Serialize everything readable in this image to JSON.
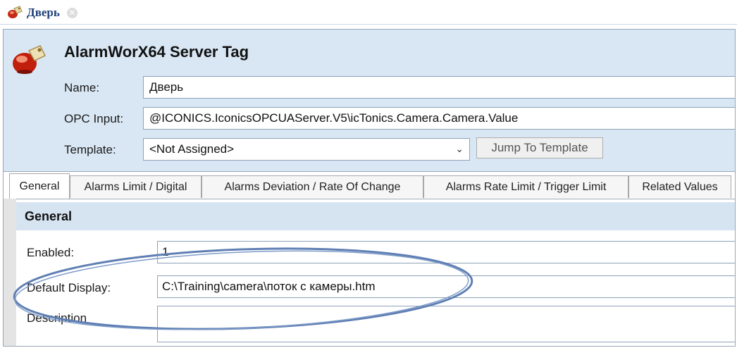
{
  "document_tab": {
    "title": "Дверь",
    "icon": "alarm-tag-icon",
    "close_icon": "close-icon"
  },
  "editor": {
    "title": "AlarmWorX64 Server Tag",
    "icon": "alarm-bell-icon",
    "fields": {
      "name_label": "Name:",
      "name_value": "Дверь",
      "opc_label": "OPC Input:",
      "opc_value": "@ICONICS.IconicsOPCUAServer.V5\\icTonics.Camera.Camera.Value",
      "template_label": "Template:",
      "template_value": "<Not Assigned>",
      "jump_button": "Jump To Template"
    },
    "tabs": [
      {
        "label": "General",
        "active": true
      },
      {
        "label": "Alarms Limit / Digital",
        "active": false
      },
      {
        "label": "Alarms Deviation / Rate Of Change",
        "active": false
      },
      {
        "label": "Alarms Rate Limit  / Trigger Limit",
        "active": false
      },
      {
        "label": "Related Values",
        "active": false
      }
    ],
    "general": {
      "header": "General",
      "enabled_label": "Enabled:",
      "enabled_value": "1",
      "default_display_label": "Default Display:",
      "default_display_value": "C:\\Training\\camera\\поток с камеры.htm",
      "description_label": "Description",
      "description_value": ""
    }
  },
  "colors": {
    "header_panel": "#d9e7f4",
    "section_header": "#d6e4f2",
    "annotation_ellipse": "#5f7fb3",
    "doc_tab_text": "#1f3f7a"
  }
}
